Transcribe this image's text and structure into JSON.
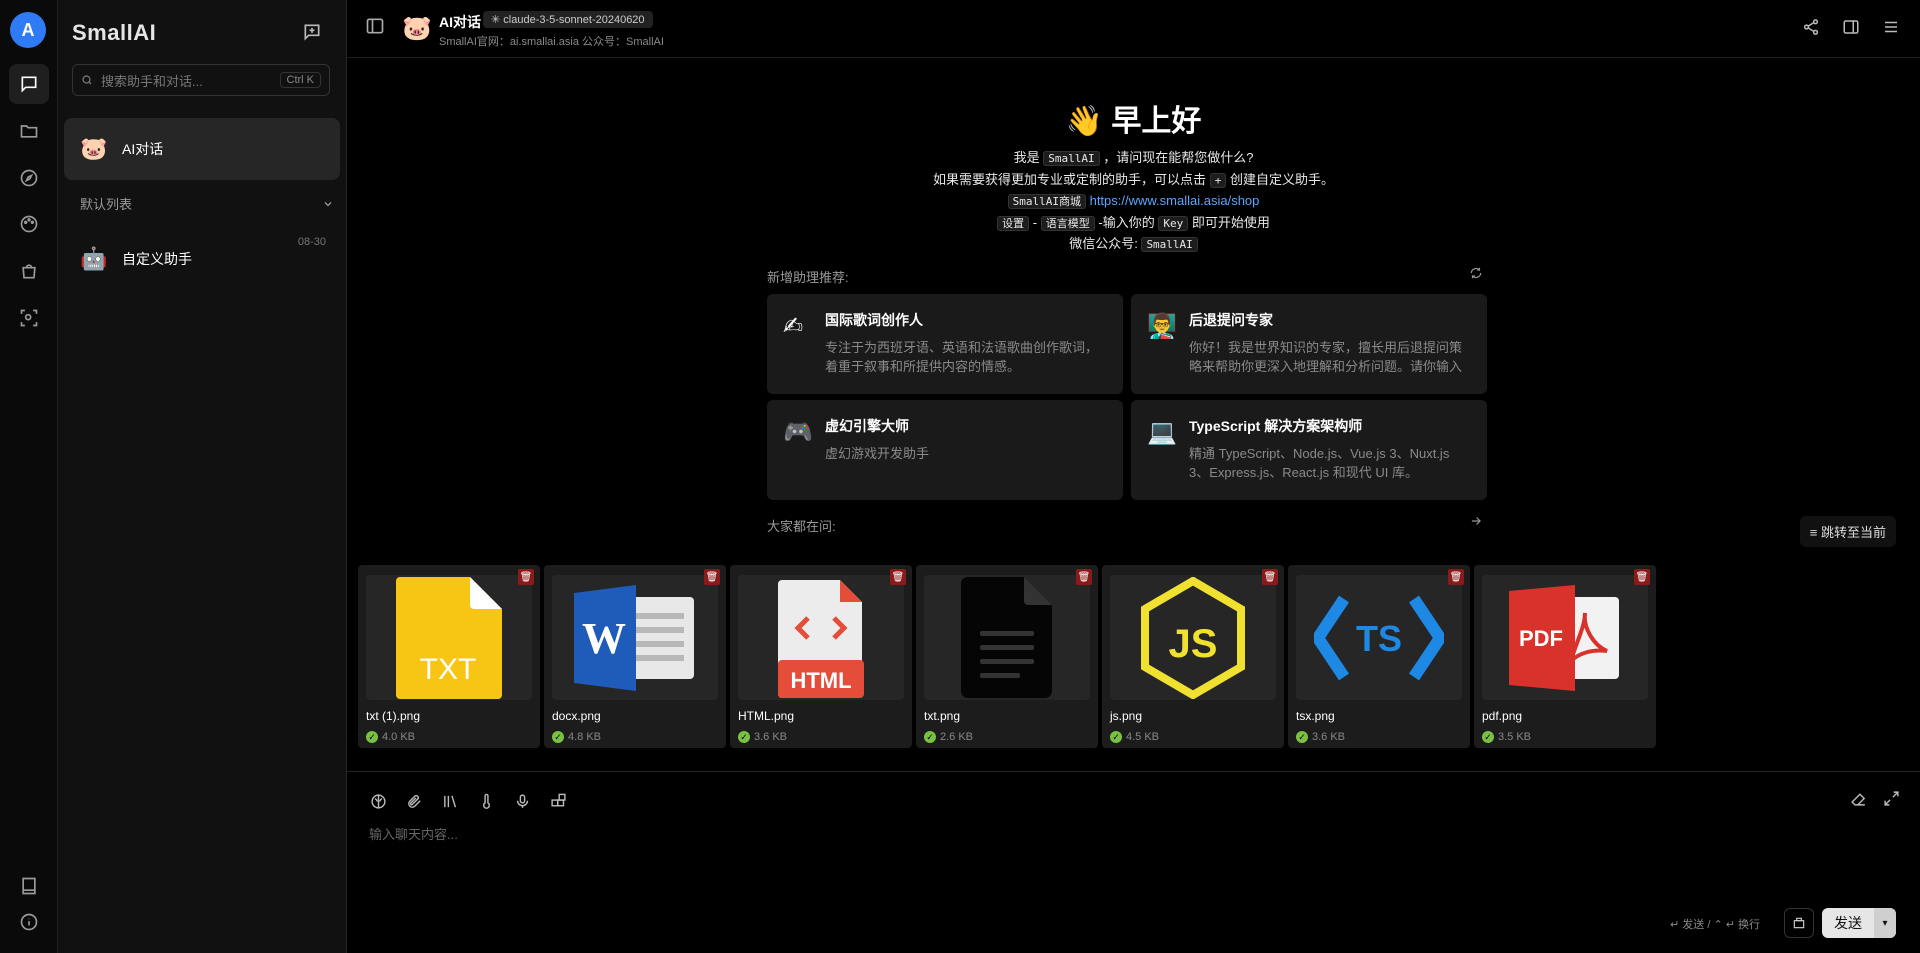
{
  "app": {
    "name": "SmallAI",
    "logo_text": "A"
  },
  "sidebar": {
    "search_placeholder": "搜索助手和对话...",
    "search_shortcut": "Ctrl K",
    "session": {
      "label": "AI对话",
      "avatar": "🐷"
    },
    "group": {
      "label": "默认列表"
    },
    "assistant": {
      "label": "自定义助手",
      "date": "08-30",
      "avatar": "🤖"
    }
  },
  "header": {
    "title": "AI对话",
    "model": "✳ claude-3-5-sonnet-20240620",
    "subtitle": "SmallAI官网：ai.smallai.asia 公众号：SmallAI"
  },
  "welcome": {
    "greeting": "👋 早上好",
    "line1_pre": "我是",
    "line1_code": "SmallAI",
    "line1_post": "，请问现在能帮您做什么?",
    "line2_pre": "如果需要获得更加专业或定制的助手，可以点击",
    "line2_code": "+",
    "line2_post": "创建自定义助手。",
    "line3_code": "SmallAI商城",
    "line3_link": "https://www.smallai.asia/shop",
    "line4_code1": "设置",
    "line4_sep": "-",
    "line4_code2": "语言模型",
    "line4_mid": "-输入你的",
    "line4_code3": "Key",
    "line4_post": "即可开始使用",
    "line5_pre": "微信公众号:",
    "line5_code": "SmallAI"
  },
  "recommend": {
    "label": "新增助理推荐:",
    "cards": [
      {
        "icon": "✍",
        "title": "国际歌词创作人",
        "desc": "专注于为西班牙语、英语和法语歌曲创作歌词，着重于叙事和所提供内容的情感。"
      },
      {
        "icon": "👨‍🏫",
        "title": "后退提问专家",
        "desc": "你好！我是世界知识的专家，擅长用后退提问策略来帮助你更深入地理解和分析问题。请你输入一..."
      },
      {
        "icon": "🎮",
        "title": "虚幻引擎大师",
        "desc": "虚幻游戏开发助手"
      },
      {
        "icon": "💻",
        "title": "TypeScript 解决方案架构师",
        "desc": "精通 TypeScript、Node.js、Vue.js 3、Nuxt.js 3、Express.js、React.js 和现代 UI 库。"
      }
    ]
  },
  "ask": {
    "label": "大家都在问:"
  },
  "jump_label": "跳转至当前",
  "files": [
    {
      "name": "txt (1).png",
      "size": "4.0 KB",
      "kind": "txt-yellow",
      "thumb_text": "TXT"
    },
    {
      "name": "docx.png",
      "size": "4.8 KB",
      "kind": "word",
      "thumb_text": "W"
    },
    {
      "name": "HTML.png",
      "size": "3.6 KB",
      "kind": "html",
      "thumb_text": "HTML"
    },
    {
      "name": "txt.png",
      "size": "2.6 KB",
      "kind": "txt-black",
      "thumb_text": ""
    },
    {
      "name": "js.png",
      "size": "4.5 KB",
      "kind": "js",
      "thumb_text": "JS"
    },
    {
      "name": "tsx.png",
      "size": "3.6 KB",
      "kind": "ts",
      "thumb_text": "TS"
    },
    {
      "name": "pdf.png",
      "size": "3.5 KB",
      "kind": "pdf",
      "thumb_text": "PDF"
    }
  ],
  "input": {
    "placeholder": "输入聊天内容...",
    "hint": "↵ 发送 / ⌃ ↵ 换行",
    "send_label": "发送"
  },
  "colors": {
    "accent": "#2f7bf6",
    "link": "#58a6ff",
    "success": "#7ac143",
    "delete": "#8b1a1a"
  }
}
